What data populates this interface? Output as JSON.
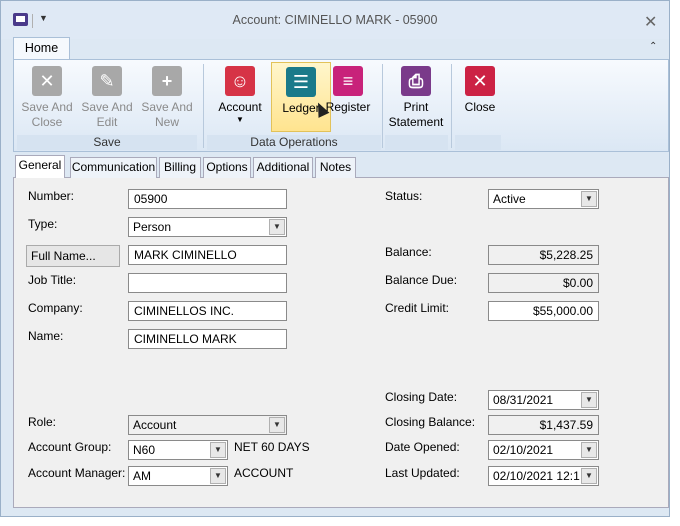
{
  "window": {
    "title": "Account: CIMINELLO MARK - 05900"
  },
  "ribbon": {
    "tab": "Home",
    "groups": [
      {
        "label": "Save"
      },
      {
        "label": "Data Operations"
      }
    ],
    "buttons": {
      "save_and_close": "Save And Close",
      "save_and_edit": "Save And Edit",
      "save_and_new": "Save And New",
      "account": "Account",
      "ledger": "Ledger",
      "register": "Register",
      "print_statement": "Print Statement",
      "close": "Close"
    }
  },
  "tabs": [
    "General",
    "Communication",
    "Billing",
    "Options",
    "Additional",
    "Notes"
  ],
  "form": {
    "number_label": "Number:",
    "number": "05900",
    "type_label": "Type:",
    "type": "Person",
    "fullname_button": "Full Name...",
    "fullname": "MARK CIMINELLO",
    "jobtitle_label": "Job Title:",
    "jobtitle": "",
    "company_label": "Company:",
    "company": "CIMINELLOS INC.",
    "name_label": "Name:",
    "name": "CIMINELLO MARK",
    "role_label": "Role:",
    "role": "Account",
    "account_group_label": "Account Group:",
    "account_group": "N60",
    "account_group_desc": "NET 60 DAYS",
    "account_manager_label": "Account Manager:",
    "account_manager": "AM",
    "account_manager_desc": "ACCOUNT",
    "status_label": "Status:",
    "status": "Active",
    "balance_label": "Balance:",
    "balance": "$5,228.25",
    "balance_due_label": "Balance Due:",
    "balance_due": "$0.00",
    "credit_limit_label": "Credit Limit:",
    "credit_limit": "$55,000.00",
    "closing_date_label": "Closing Date:",
    "closing_date": "08/31/2021",
    "closing_balance_label": "Closing Balance:",
    "closing_balance": "$1,437.59",
    "date_opened_label": "Date Opened:",
    "date_opened": "02/10/2021",
    "last_updated_label": "Last Updated:",
    "last_updated": "02/10/2021 12:1"
  }
}
